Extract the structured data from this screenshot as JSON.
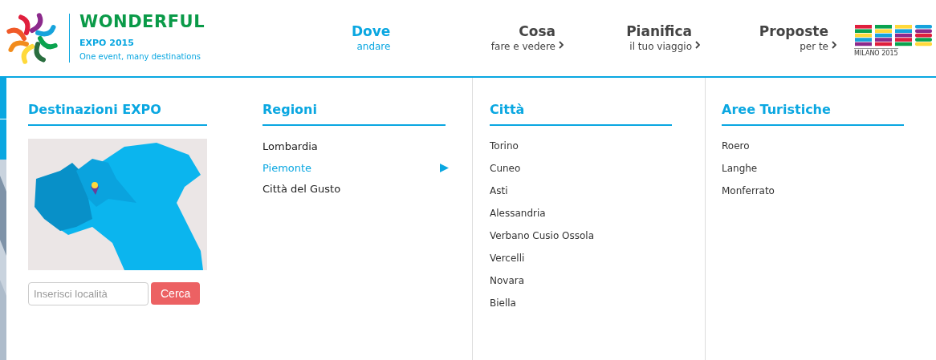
{
  "brand": {
    "title": "WONDERFUL",
    "subtitle": "EXPO 2015",
    "tagline": "One event, many destinations"
  },
  "nav": [
    {
      "title": "Dove",
      "subtitle": "andare",
      "selected": true
    },
    {
      "title": "Cosa",
      "subtitle": "fare e vedere",
      "selected": false
    },
    {
      "title": "Pianifica",
      "subtitle": "il tuo viaggio",
      "selected": false
    },
    {
      "title": "Proposte",
      "subtitle": "per te",
      "selected": false
    }
  ],
  "expo_logo": {
    "caption": "MILANO 2015"
  },
  "destinations": {
    "heading": "Destinazioni EXPO",
    "search": {
      "placeholder": "Inserisci località",
      "button": "Cerca"
    }
  },
  "regions": {
    "heading": "Regioni",
    "items": [
      {
        "label": "Lombardia",
        "selected": false
      },
      {
        "label": "Piemonte",
        "selected": true
      },
      {
        "label": "Città del Gusto",
        "selected": false
      }
    ]
  },
  "cities": {
    "heading": "Città",
    "items": [
      "Torino",
      "Cuneo",
      "Asti",
      "Alessandria",
      "Verbano Cusio Ossola",
      "Vercelli",
      "Novara",
      "Biella"
    ]
  },
  "tourist_areas": {
    "heading": "Aree Turistiche",
    "items": [
      "Roero",
      "Langhe",
      "Monferrato"
    ]
  }
}
